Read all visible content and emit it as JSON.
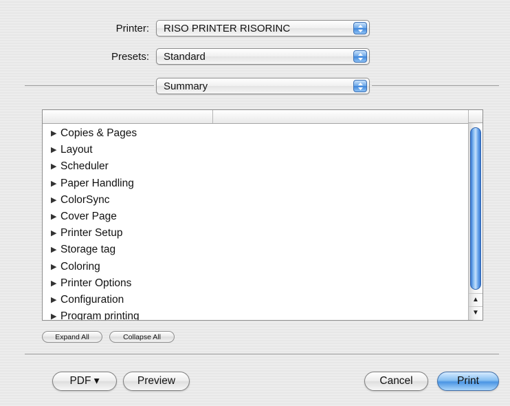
{
  "printer": {
    "label": "Printer:",
    "value": "RISO PRINTER RISORINC"
  },
  "presets": {
    "label": "Presets:",
    "value": "Standard"
  },
  "panel": {
    "value": "Summary"
  },
  "outline": {
    "items": [
      {
        "label": "Copies & Pages"
      },
      {
        "label": "Layout"
      },
      {
        "label": "Scheduler"
      },
      {
        "label": "Paper Handling"
      },
      {
        "label": "ColorSync"
      },
      {
        "label": "Cover Page"
      },
      {
        "label": "Printer Setup"
      },
      {
        "label": "Storage tag"
      },
      {
        "label": "Coloring"
      },
      {
        "label": "Printer Options"
      },
      {
        "label": "Configuration"
      },
      {
        "label": "Program printing"
      }
    ],
    "expand_all": "Expand All",
    "collapse_all": "Collapse All",
    "scroll_up_glyph": "▲",
    "scroll_down_glyph": "▼",
    "disclosure_glyph": "▶"
  },
  "buttons": {
    "pdf": "PDF ▾",
    "preview": "Preview",
    "cancel": "Cancel",
    "print": "Print"
  },
  "colors": {
    "accent": "#4b95e3",
    "scroll_thumb": "#6aa5ea"
  },
  "icons": {
    "popup": "updown-arrows-icon",
    "disclosure": "disclosure-triangle-icon"
  }
}
